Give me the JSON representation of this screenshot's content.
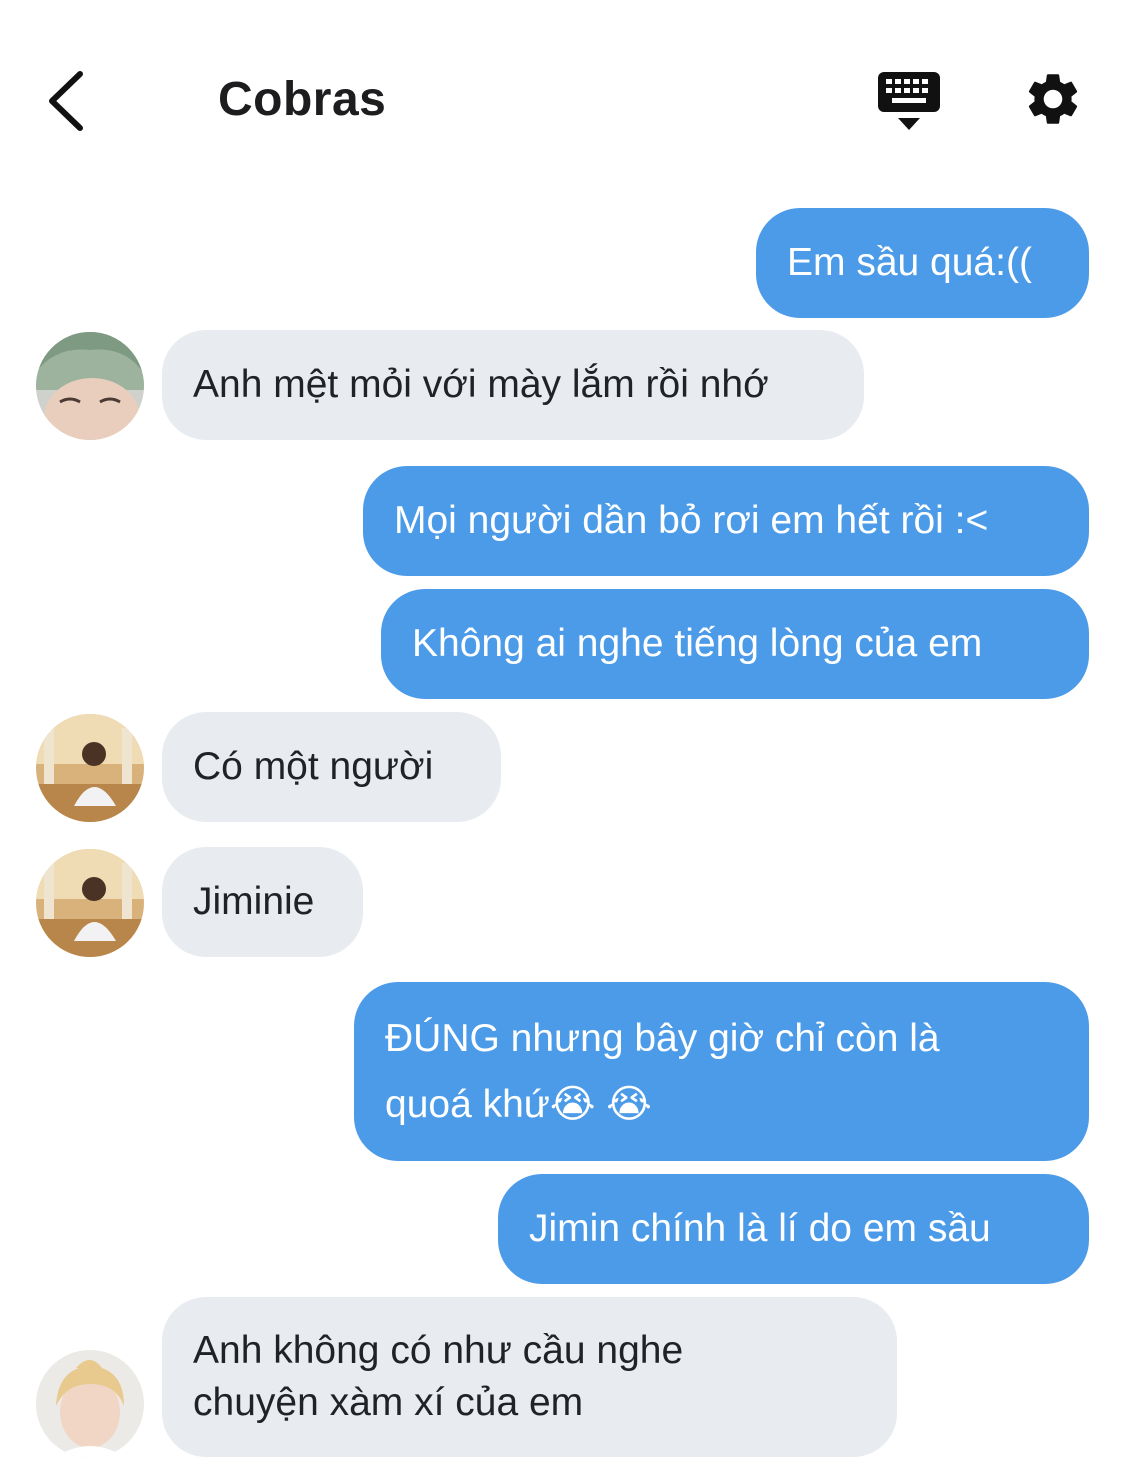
{
  "header": {
    "title": "Cobras",
    "icons": {
      "back": "chevron-left-icon",
      "keyboard": "keyboard-hide-icon",
      "settings": "gear-icon"
    }
  },
  "colors": {
    "outgoing_bubble": "#4c9be8",
    "incoming_bubble": "#e8ebef",
    "outgoing_text": "#ffffff",
    "incoming_text": "#1f2226"
  },
  "messages": [
    {
      "direction": "out",
      "text": "Em sầu quá:(("
    },
    {
      "direction": "in",
      "avatar": "avatar-green-hair",
      "text": "Anh mệt mỏi với mày lắm rồi nhớ"
    },
    {
      "direction": "out",
      "text": "Mọi người dần bỏ rơi em hết rồi :<"
    },
    {
      "direction": "out",
      "text": "Không ai nghe tiếng lòng của em"
    },
    {
      "direction": "in",
      "avatar": "avatar-sunset-photo",
      "text": "Có một người"
    },
    {
      "direction": "in",
      "avatar": "avatar-sunset-photo",
      "text": "Jiminie"
    },
    {
      "direction": "out",
      "lines": [
        "ĐÚNG nhưng bây giờ chỉ còn là",
        "quoá khứ😭 😭"
      ]
    },
    {
      "direction": "out",
      "text": "Jimin chính là lí do em sầu"
    },
    {
      "direction": "in",
      "avatar": "avatar-blonde-hair",
      "lines": [
        "Anh không có như cầu nghe",
        "chuyện xàm xí của em"
      ]
    }
  ]
}
